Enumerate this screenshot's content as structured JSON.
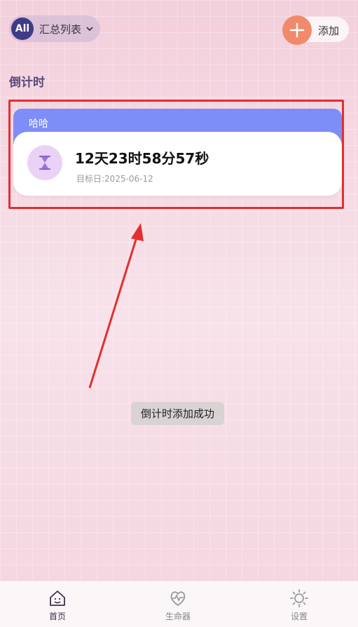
{
  "header": {
    "all_badge": "All",
    "selector_label": "汇总列表",
    "add_label": "添加"
  },
  "section": {
    "title": "倒计时"
  },
  "countdown_card": {
    "name": "哈哈",
    "remaining": "12天23时58分57秒",
    "target_date": "目标日:2025-06-12"
  },
  "toast": {
    "message": "倒计时添加成功"
  },
  "bottom_nav": {
    "items": [
      {
        "label": "首页",
        "icon": "home-icon",
        "active": true
      },
      {
        "label": "生命器",
        "icon": "heart-pulse-icon",
        "active": false
      },
      {
        "label": "设置",
        "icon": "gear-icon",
        "active": false
      }
    ]
  },
  "colors": {
    "accent": "#7e8ef8",
    "add_button": "#f08a6a",
    "highlight": "#e13030",
    "badge": "#3f3b86"
  }
}
